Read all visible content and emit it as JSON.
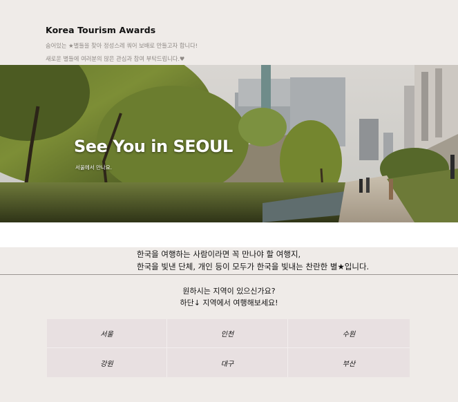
{
  "header": {
    "title": "Korea Tourism Awards",
    "tagline_1": "숨어있는 ★별들을 찾아 정성스레 쿼어 보배로 만들고자 합니다!",
    "tagline_2": "새로운 별들에 여러분의 많은 관심과 참여 부탁드립니다.♥"
  },
  "hero": {
    "title": "See You in SEOUL",
    "subtitle": "서울에서 만나요."
  },
  "intro": {
    "line_1": "한국을 여행하는 사람이라면 꼭 만나야 할 여행지,",
    "line_2": "한국을 빛낸 단체, 개인 등이 모두가 한국을 빛내는 찬란한 별★입니다."
  },
  "prompt": {
    "line_1": "원하시는 지역이 있으신가요?",
    "line_2": "하단↓ 지역에서 여행해보세요!"
  },
  "regions": [
    "서울",
    "인천",
    "수원",
    "강원",
    "대구",
    "부산"
  ],
  "colors": {
    "background": "#efebe8",
    "region_cell": "#e8e0e1",
    "tagline": "#8f8a86"
  }
}
